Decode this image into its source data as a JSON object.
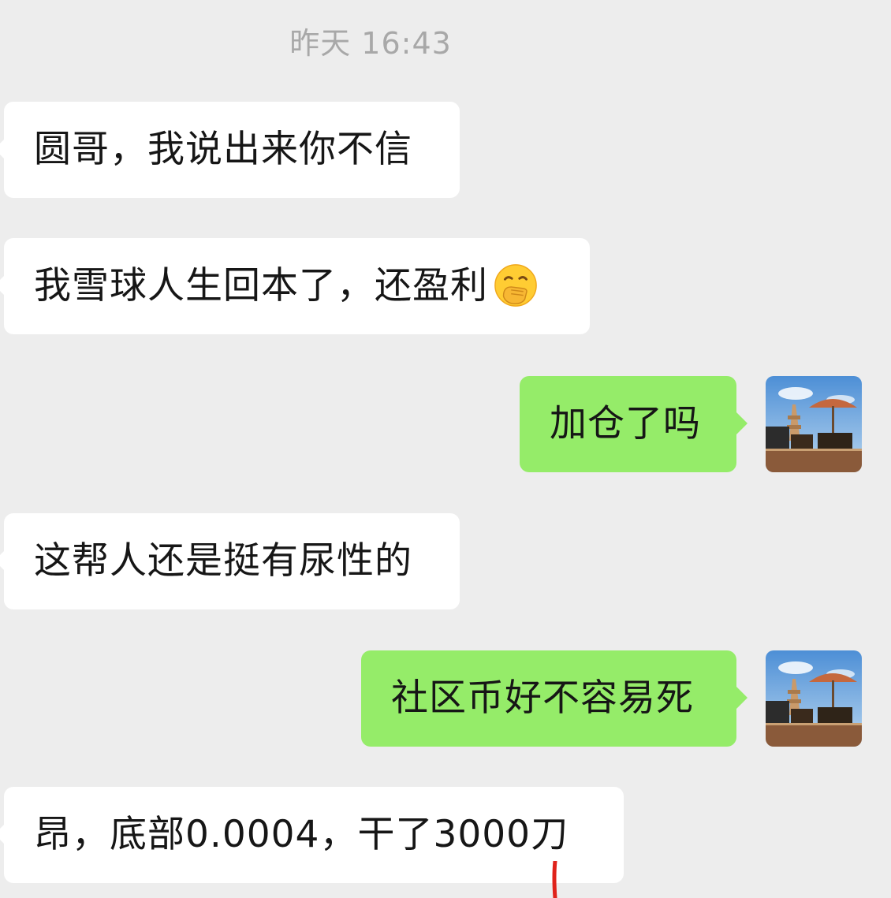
{
  "chat": {
    "timestamp": "昨天 16:43",
    "messages": [
      {
        "side": "left",
        "text": "圆哥，我说出来你不信"
      },
      {
        "side": "left",
        "text": "我雪球人生回本了，还盈利",
        "emoji": "hand-over-mouth-emoji"
      },
      {
        "side": "right",
        "text": "加仓了吗"
      },
      {
        "side": "left",
        "text": "这帮人还是挺有尿性的"
      },
      {
        "side": "right",
        "text": "社区币好不容易死"
      },
      {
        "side": "left",
        "text": "昂，底部0.0004，干了3000刀"
      }
    ]
  },
  "colors": {
    "background": "#ededed",
    "incoming_bubble": "#ffffff",
    "outgoing_bubble": "#95ec69",
    "timestamp_text": "#a8a8a8",
    "annotation_mark": "#e0231b"
  }
}
